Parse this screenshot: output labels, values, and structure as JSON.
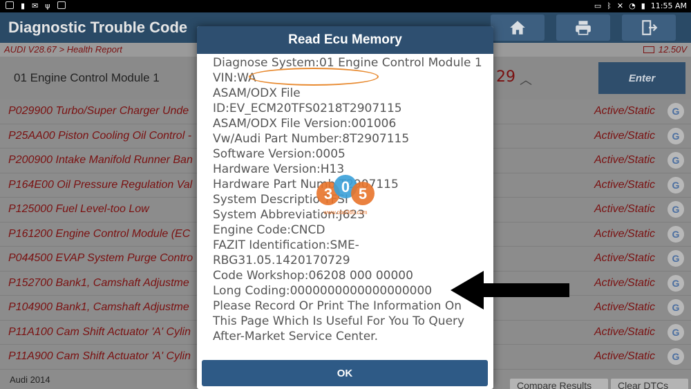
{
  "statusbar": {
    "time": "11:55 AM"
  },
  "header": {
    "title": "Diagnostic Trouble Code",
    "breadcrumb": "AUDI V28.67 > Health Report",
    "voltage": "12.50V",
    "buttons": [
      "home-icon",
      "print-icon",
      "exit-icon"
    ]
  },
  "module": {
    "name": "01 Engine Control Module 1",
    "count": "29",
    "enter_label": "Enter"
  },
  "dtcs": [
    {
      "code": "P029900 Turbo/Super Charger Unde",
      "status": "Active/Static"
    },
    {
      "code": "P25AA00 Piston Cooling Oil Control -",
      "status": "Active/Static"
    },
    {
      "code": "P200900 Intake Manifold Runner Ban",
      "status": "Active/Static"
    },
    {
      "code": "P164E00 Oil Pressure Regulation Val",
      "status": "Active/Static"
    },
    {
      "code": "P125000 Fuel Level-too Low",
      "status": "Active/Static"
    },
    {
      "code": "P161200 Engine Control Module (EC",
      "status": "Active/Static"
    },
    {
      "code": "P044500 EVAP System Purge Contro",
      "status": "Active/Static"
    },
    {
      "code": "P152700 Bank1, Camshaft Adjustme",
      "status": "Active/Static"
    },
    {
      "code": "P104900 Bank1, Camshaft Adjustme",
      "status": "Active/Static"
    },
    {
      "code": "P11A100 Cam Shift Actuator 'A' Cylin",
      "status": "Active/Static"
    },
    {
      "code": "P11A900 Cam Shift Actuator 'A' Cylin",
      "status": "Active/Static"
    }
  ],
  "bottombar": {
    "vehicle": "Audi  2014",
    "compare_label": "Compare Results",
    "clear_label": "Clear DTCs"
  },
  "modal": {
    "title": "Read Ecu Memory",
    "lines": [
      "Diagnose System:01 Engine Control Module 1",
      "VIN:WA",
      "ASAM/ODX File",
      "ID:EV_ECM20TFS0218T2907115",
      "ASAM/ODX File Version:001006",
      "Vw/Audi Part Number:8T2907115",
      "Software Version:0005",
      "Hardware Version:H13",
      "Hardware Part Numb      T2907115",
      "System Descriptio      TFSI",
      "System Abbreviation:J623",
      "Engine Code:CNCD",
      "FAZIT Identification:SME-",
      "RBG31.05.1420170729",
      "Code Workshop:06208  000  00000",
      "Long Coding:0000000000000000000",
      "Please Record Or Print The Information On",
      "This Page Which Is Useful For You To Query",
      "After-Market Service Center."
    ],
    "ok_label": "OK"
  },
  "watermark": {
    "digits": [
      "3",
      "0",
      "5"
    ],
    "url": "www.obd365.com"
  },
  "colors": {
    "header": "#2a4a66",
    "modal_title": "#2e4f70",
    "ok": "#2e5a86",
    "dtc_text": "#7a1010",
    "annotation": "#e88a30",
    "arrow": "#000000"
  }
}
